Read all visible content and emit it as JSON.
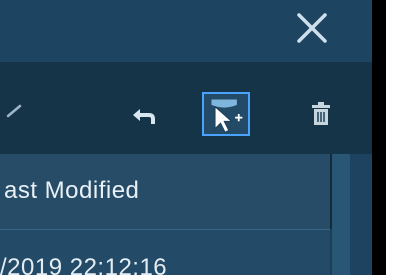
{
  "titlebar": {
    "close_icon": "close-icon"
  },
  "toolbar": {
    "dropdown_icon": "chevron-down-icon",
    "undo_icon": "undo-icon",
    "select_icon": "select-cursor-icon",
    "delete_icon": "trash-icon",
    "select_active_color": "#4aa3ff"
  },
  "table": {
    "columns": [
      {
        "label": "ast Modified"
      }
    ],
    "rows": [
      {
        "last_modified": "/2019 22:12:16"
      }
    ]
  }
}
